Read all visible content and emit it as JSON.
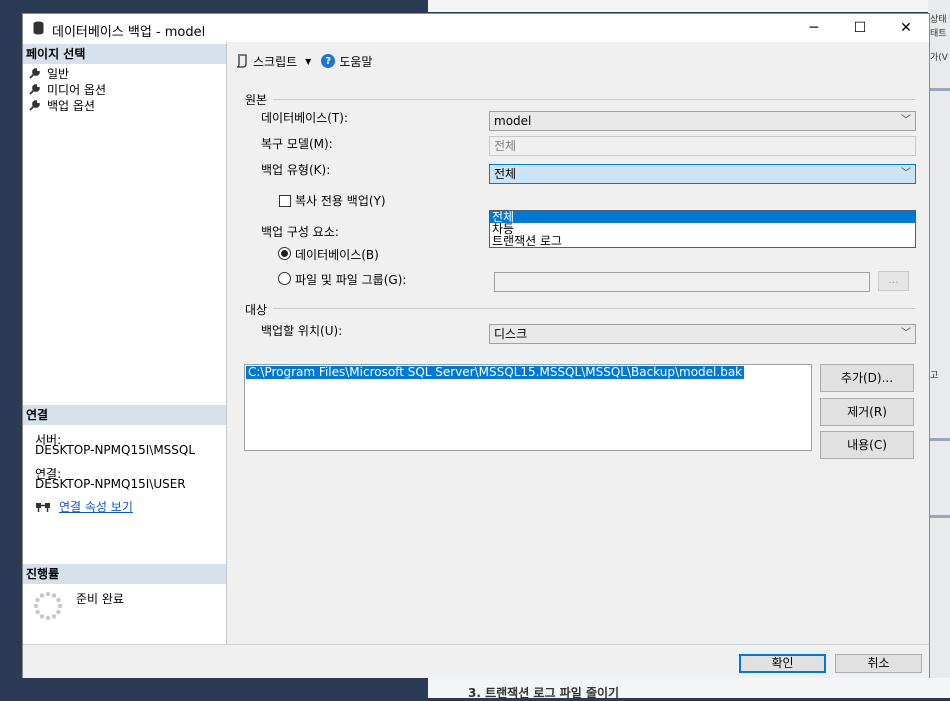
{
  "window": {
    "title": "데이터베이스 백업 - model",
    "minimize": "─",
    "maximize": "☐",
    "close": "✕"
  },
  "left": {
    "page_select_title": "페이지 선택",
    "pages": [
      "일반",
      "미디어 옵션",
      "백업 옵션"
    ],
    "connection_title": "연결",
    "server_label": "서버:",
    "server_value": "DESKTOP-NPMQ15I\\MSSQL",
    "conn_label": "연결:",
    "conn_value": "DESKTOP-NPMQ15I\\USER",
    "conn_props_link": "연결 속성 보기",
    "progress_title": "진행률",
    "progress_status": "준비 완료"
  },
  "toolbar": {
    "script_label": "스크립트",
    "script_arrow": "▼",
    "help_label": "도움말",
    "help_glyph": "?"
  },
  "source": {
    "group_label": "원본",
    "database_label": "데이터베이스(T):",
    "database_value": "model",
    "recovery_label": "복구 모델(M):",
    "recovery_value": "전체",
    "backup_type_label": "백업 유형(K):",
    "backup_type_value": "전체",
    "backup_type_options": [
      "전체",
      "차등",
      "트랜잭션 로그"
    ],
    "copy_only_label": "복사 전용 백업(Y)",
    "component_label": "백업 구성 요소:",
    "component_db_label": "데이터베이스(B)",
    "component_files_label": "파일 및 파일 그룹(G):",
    "browse_label": "..."
  },
  "destination": {
    "group_label": "대상",
    "backup_to_label": "백업할 위치(U):",
    "backup_to_value": "디스크",
    "paths": [
      "C:\\Program Files\\Microsoft SQL Server\\MSSQL15.MSSQL\\MSSQL\\Backup\\model.bak"
    ],
    "add_button": "추가(D)...",
    "remove_button": "제거(R)",
    "contents_button": "내용(C)"
  },
  "footer": {
    "ok_button": "확인",
    "cancel_button": "취소"
  },
  "background": {
    "partial_text": "3. 트랜잭션 로그 파일 줄이기",
    "side_snippets": [
      "상태",
      "태트",
      "가(V",
      "고"
    ]
  },
  "colors": {
    "accent": "#0078d7",
    "section_header": "#d7e1ec",
    "link": "#0b57d0"
  }
}
